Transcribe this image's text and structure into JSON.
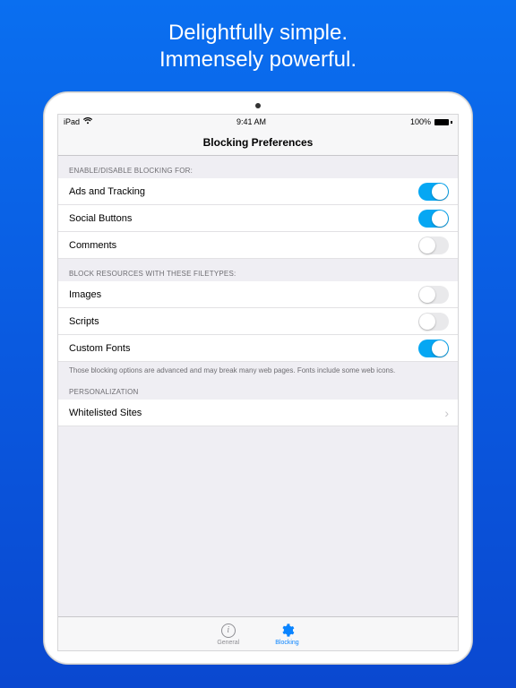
{
  "marketing": {
    "line1": "Delightfully simple.",
    "line2": "Immensely powerful."
  },
  "statusbar": {
    "device": "iPad",
    "time": "9:41 AM",
    "battery_pct": "100%"
  },
  "navbar": {
    "title": "Blocking Preferences"
  },
  "sections": {
    "blocking": {
      "header": "ENABLE/DISABLE BLOCKING FOR:",
      "items": [
        {
          "label": "Ads and Tracking",
          "on": true
        },
        {
          "label": "Social Buttons",
          "on": true
        },
        {
          "label": "Comments",
          "on": false
        }
      ]
    },
    "resources": {
      "header": "BLOCK RESOURCES WITH THESE FILETYPES:",
      "items": [
        {
          "label": "Images",
          "on": false
        },
        {
          "label": "Scripts",
          "on": false
        },
        {
          "label": "Custom Fonts",
          "on": true
        }
      ],
      "footer": "Those blocking options are advanced and may break many web pages. Fonts include some web icons."
    },
    "personalization": {
      "header": "PERSONALIZATION",
      "items": [
        {
          "label": "Whitelisted Sites"
        }
      ]
    }
  },
  "tabbar": {
    "general": "General",
    "blocking": "Blocking"
  }
}
